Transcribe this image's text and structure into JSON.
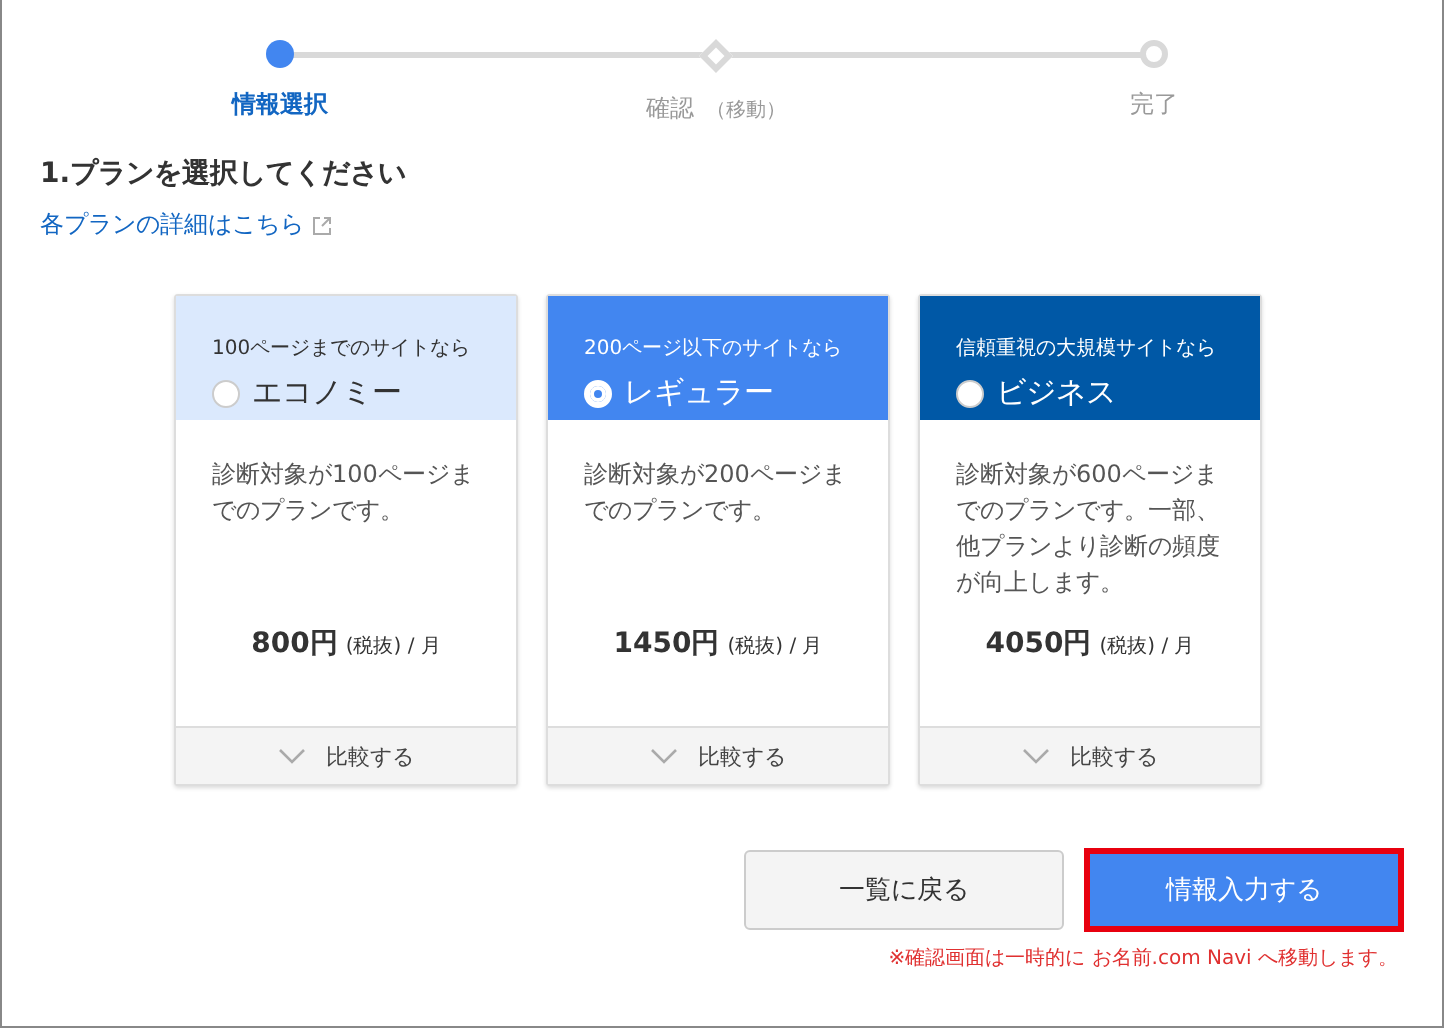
{
  "steps": [
    {
      "label": "情報選択",
      "kind": "circle",
      "selected": true
    },
    {
      "label": "確認",
      "note": "（移動）",
      "kind": "diamond",
      "selected": false
    },
    {
      "label": "完了",
      "kind": "circle",
      "selected": false
    }
  ],
  "heading": "1.プランを選択してください",
  "details_link": "各プランの詳細はこちら",
  "plans": [
    {
      "tagline": "100ページまでのサイトなら",
      "name": "エコノミー",
      "color": "#dbe9fd",
      "selected": false,
      "description": "診断対象が100ページまでのプランです。",
      "price": "800円",
      "tax": "(税抜) / 月",
      "compare": "比較する"
    },
    {
      "tagline": "200ページ以下のサイトなら",
      "name": "レギュラー",
      "color": "#4286f0",
      "selected": true,
      "description": "診断対象が200ページまでのプランです。",
      "price": "1450円",
      "tax": "(税抜) / 月",
      "compare": "比較する"
    },
    {
      "tagline": "信頼重視の大規模サイトなら",
      "name": "ビジネス",
      "color": "#0058a6",
      "selected": false,
      "description": "診断対象が600ページまでのプランです。一部、他プランより診断の頻度が向上します。",
      "price": "4050円",
      "tax": "(税抜) / 月",
      "compare": "比較する"
    }
  ],
  "back_button": "一覧に戻る",
  "submit_button": "情報入力する",
  "notice": "※確認画面は一時的に お名前.com Navi へ移動します。"
}
